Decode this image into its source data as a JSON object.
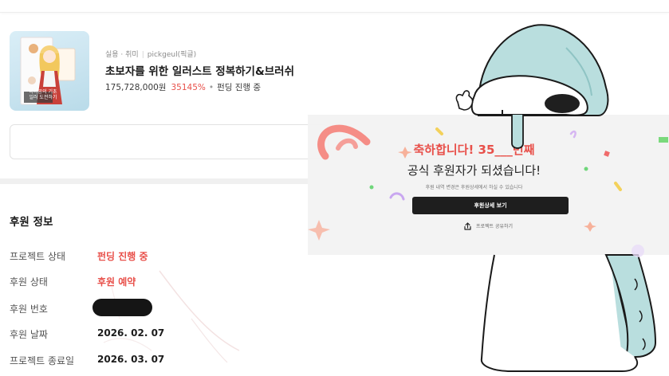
{
  "project": {
    "category": "실용 · 취미",
    "creator": "pickgeul(픽글)",
    "title": "초보자를 위한 일러스트 정복하기&브러쉬",
    "amount": "175,728,000원",
    "percent": "35145%",
    "status": "펀딩 진행 중",
    "thumbnail_caption": "나나공의 기초 일러 도전하기"
  },
  "support_info": {
    "heading": "후원 정보",
    "rows": [
      {
        "label": "프로젝트 상태",
        "value": "펀딩 진행 중"
      },
      {
        "label": "후원 상태",
        "value": "후원 예약"
      },
      {
        "label": "후원 번호",
        "value": ""
      },
      {
        "label": "후원 날짜",
        "value": "2026. 02. 07"
      },
      {
        "label": "프로젝트 종료일",
        "value": "2026. 03. 07"
      }
    ]
  },
  "popup": {
    "headline": "축하합니다! 35___번째",
    "subtitle": "공식 후원자가 되셨습니다!",
    "note": "후원 내역 변경은 후원상세에서 하실 수 있습니다",
    "button_label": "후원상세 보기",
    "share_label": "프로젝트 공유하기"
  },
  "colors": {
    "accent": "#e8504a",
    "button": "#1e1e1e",
    "character_body": "#b9dede"
  },
  "icons": {
    "share": "share-icon",
    "character": "mascot-character"
  }
}
